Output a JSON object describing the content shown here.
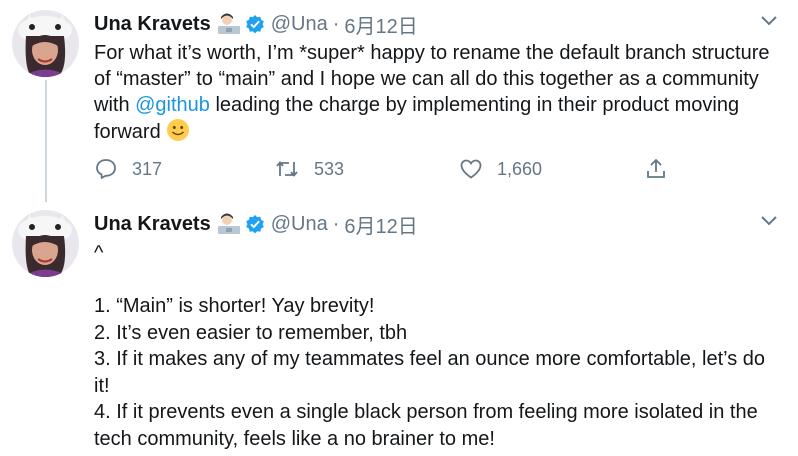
{
  "tweets": [
    {
      "author": "Una Kravets",
      "handle": "@Una",
      "date": "6月12日",
      "text_before": "For what it’s worth, I’m *super* happy to rename the default branch structure of “master” to “main” and I hope we can all do this together as a community with ",
      "mention": "@github",
      "text_after": " leading the charge by implementing in their product moving forward ",
      "emoji": "smile-emoji",
      "replies": "317",
      "retweets": "533",
      "likes": "1,660"
    },
    {
      "author": "Una Kravets",
      "handle": "@Una",
      "date": "6月12日",
      "text": "^\n\n1. “Main” is shorter! Yay brevity!\n2. It’s even easier to remember, tbh\n3. If it makes any of my teammates feel an ounce more comfortable, let’s do it!\n4. If it prevents even a single black person from feeling more isolated in the tech community, feels like a no brainer to me!"
    }
  ],
  "icons": {
    "verified": "verified-badge-icon",
    "caret": "chevron-down-icon",
    "reply": "reply-icon",
    "retweet": "retweet-icon",
    "like": "heart-icon",
    "share": "share-icon"
  },
  "colors": {
    "link": "#1b95e0",
    "verified": "#1da1f2",
    "muted": "#657786",
    "text": "#14171a"
  }
}
